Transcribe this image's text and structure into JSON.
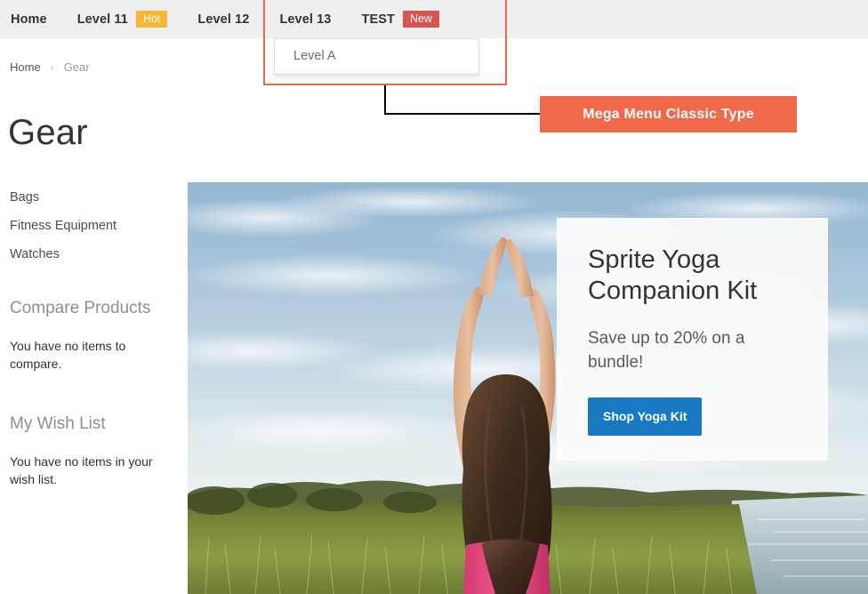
{
  "nav": {
    "items": [
      {
        "label": "Home",
        "badge": null,
        "badge_type": null,
        "active": false
      },
      {
        "label": "Level 11",
        "badge": "Hot",
        "badge_type": "hot",
        "active": false
      },
      {
        "label": "Level 12",
        "badge": null,
        "badge_type": null,
        "active": false
      },
      {
        "label": "Level 13",
        "badge": null,
        "badge_type": null,
        "active": true
      },
      {
        "label": "TEST",
        "badge": "New",
        "badge_type": "new",
        "active": false
      }
    ],
    "background_color": "#efefef",
    "badge_hot_color": "#f7b733",
    "badge_new_color": "#d9534f"
  },
  "dropdown": {
    "items": [
      {
        "label": "Level A"
      }
    ]
  },
  "annotation": {
    "label": "Mega Menu Classic Type",
    "box_color": "#ef6a4c",
    "label_bg_color": "#f0694b",
    "label_text_color": "#ffffff",
    "connector_color": "#000000"
  },
  "breadcrumb": {
    "home": "Home",
    "separator": "›",
    "current": "Gear"
  },
  "page": {
    "title": "Gear"
  },
  "sidebar": {
    "categories": [
      {
        "label": "Bags"
      },
      {
        "label": "Fitness Equipment"
      },
      {
        "label": "Watches"
      }
    ],
    "compare": {
      "title": "Compare Products",
      "empty_text": "You have no items to compare."
    },
    "wishlist": {
      "title": "My Wish List",
      "empty_text": "You have no items in your wish list."
    }
  },
  "promo": {
    "title": "Sprite Yoga Companion Kit",
    "subtitle": "Save up to 20% on a bundle!",
    "button_label": "Shop Yoga Kit",
    "button_color": "#1979c3"
  },
  "hero": {
    "alt": "Woman in yoga pose with arms raised above head at sunset by a lake",
    "sky_top_color": "#8fb3cf",
    "sky_bottom_color": "#dfe9ef",
    "grass_color": "#7d8f3d",
    "water_color": "#b9c9cf",
    "top_color": "#e0457b",
    "hair_color": "#4a3426"
  }
}
